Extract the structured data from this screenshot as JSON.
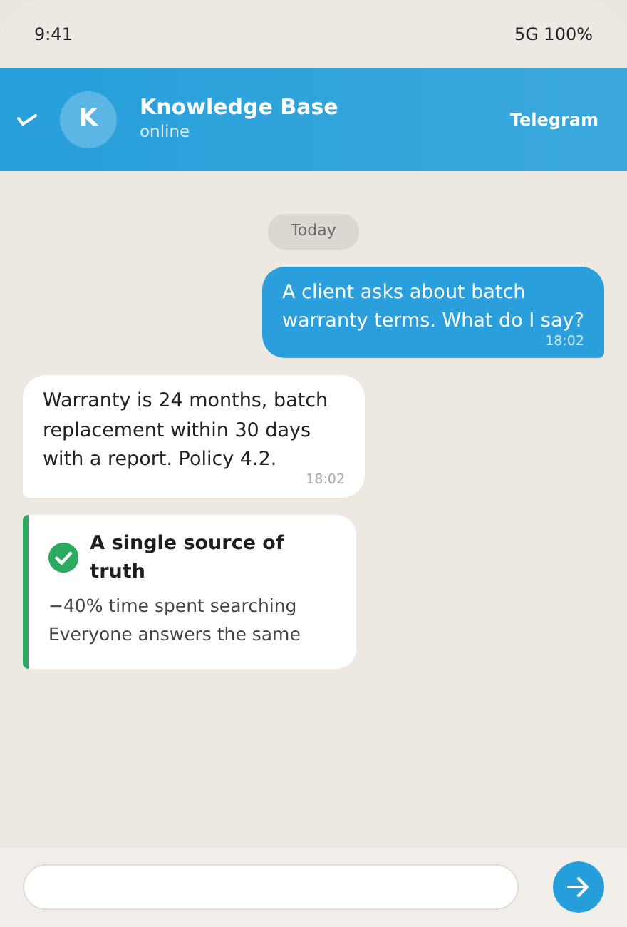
{
  "status_bar": {
    "time": "9:41",
    "indicators": "5G 100%"
  },
  "header": {
    "avatar_letter": "K",
    "title": "Knowledge Base",
    "subtitle": "online",
    "brand": "Telegram"
  },
  "date_chip": "Today",
  "messages": [
    {
      "kind": "outgoing",
      "text": "A client asks about batch warranty terms. What do I say?",
      "time": "18:02"
    },
    {
      "kind": "incoming",
      "text": "Warranty is 24 months, batch replacement within 30 days with a report. Policy 4.2.",
      "time": "18:02"
    },
    {
      "kind": "callout",
      "title": "A single source of truth",
      "lines": [
        "−40% time spent searching",
        "Everyone answers the same"
      ]
    }
  ]
}
